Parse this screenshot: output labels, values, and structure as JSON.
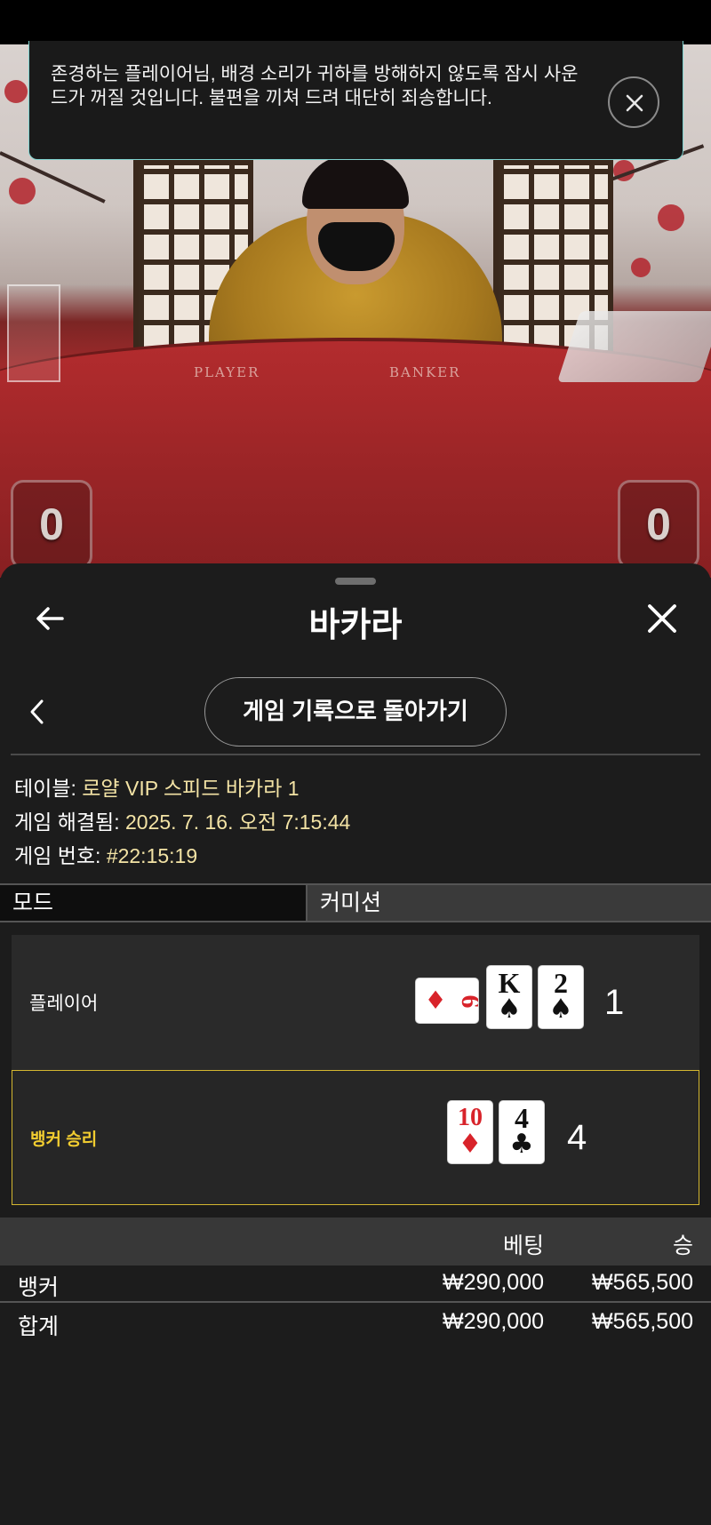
{
  "notification": {
    "message": "존경하는 플레이어님, 배경 소리가 귀하를 방해하지 않도록 잠시 사운드가 꺼질 것입니다. 불편을 끼쳐 드려 대단히 죄송합니다."
  },
  "video": {
    "table_labels": [
      "PLAYER",
      "BANKER"
    ],
    "player_score": "0",
    "banker_score": "0"
  },
  "sheet": {
    "title": "바카라",
    "history_button": "게임 기록으로 돌아가기"
  },
  "details": {
    "table_label": "테이블: ",
    "table_value": "로얄 VIP 스피드 바카라 1",
    "resolved_label": "게임 해결됨: ",
    "resolved_value": "2025. 7. 16. 오전 7:15:44",
    "number_label": "게임 번호: ",
    "number_value": "#22:15:19"
  },
  "mode": {
    "label": "모드",
    "value": "커미션"
  },
  "hands": {
    "player": {
      "label": "플레이어",
      "total": "1",
      "cards": [
        {
          "rank": "6",
          "suit": "♦",
          "color": "red"
        },
        {
          "rank": "K",
          "suit": "♠",
          "color": "black"
        },
        {
          "rank": "2",
          "suit": "♠",
          "color": "black"
        }
      ]
    },
    "banker": {
      "label": "뱅커 승리",
      "total": "4",
      "cards": [
        {
          "rank": "10",
          "suit": "♦",
          "color": "red"
        },
        {
          "rank": "4",
          "suit": "♣",
          "color": "black"
        }
      ]
    }
  },
  "bets": {
    "headers": {
      "bet": "베팅",
      "win": "승"
    },
    "rows": [
      {
        "name": "뱅커",
        "bet": "₩290,000",
        "win": "₩565,500"
      },
      {
        "name": "합계",
        "bet": "₩290,000",
        "win": "₩565,500"
      }
    ]
  },
  "colors": {
    "win_gold": "#f2cd30",
    "detail_value": "#f3e3a5",
    "notice_border": "#7fd3d0"
  }
}
